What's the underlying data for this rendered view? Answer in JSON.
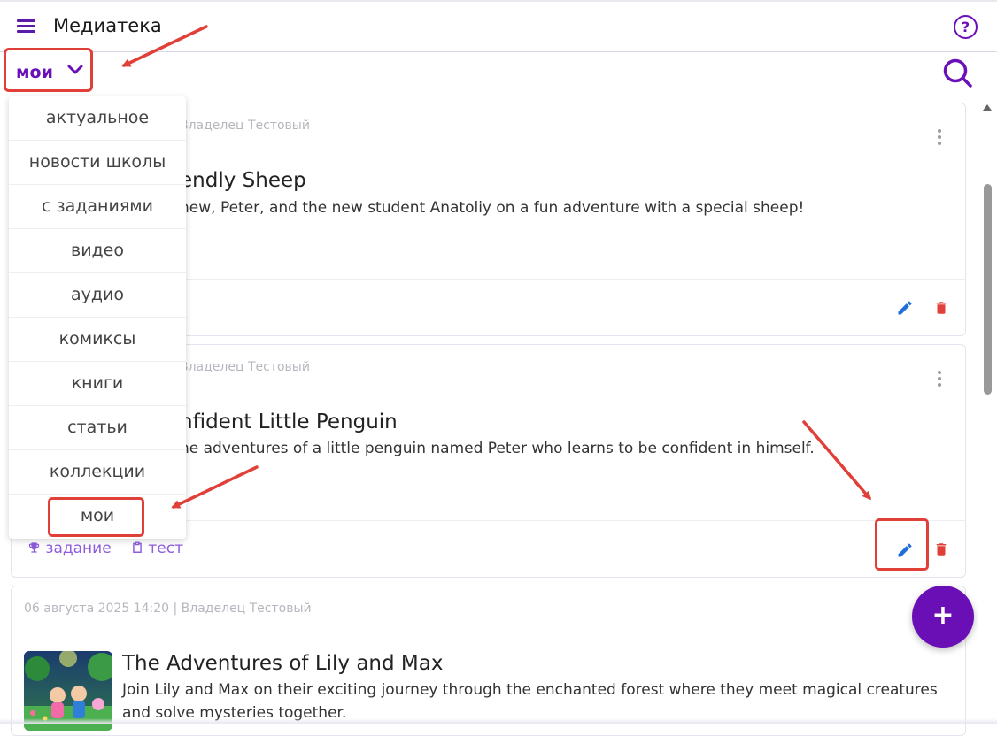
{
  "header": {
    "title": "Медиатека"
  },
  "filter": {
    "selected": "мои"
  },
  "menu": {
    "items": [
      "актуальное",
      "новости школы",
      "с заданиями",
      "видео",
      "аудио",
      "комиксы",
      "книги",
      "статьи",
      "коллекции",
      "мои"
    ]
  },
  "cards": [
    {
      "meta": "Владелец Тестовый",
      "title": "endly Sheep",
      "description": "hew, Peter, and the new student Anatoliy on a fun adventure with a special sheep!"
    },
    {
      "meta": "Владелец Тестовый",
      "title": "nfident Little Penguin",
      "description": "he adventures of a little penguin named Peter who learns to be confident in himself.",
      "tags": [
        "задание",
        "тест"
      ]
    },
    {
      "meta": "06 августа 2025 14:20 | Владелец Тестовый",
      "title": "The Adventures of Lily and Max",
      "description": "Join Lily and Max on their exciting journey through the enchanted forest where they meet magical creatures and solve mysteries together."
    }
  ],
  "fab": {
    "label": "+"
  },
  "colors": {
    "accent": "#6a0eb6",
    "annotation": "#e04038",
    "edit": "#1f6fd6",
    "delete": "#e04038"
  },
  "icons": [
    "menu-icon",
    "help-icon",
    "chevron-down-icon",
    "search-icon",
    "more-vert-icon",
    "edit-icon",
    "trash-icon",
    "trophy-icon",
    "clipboard-icon",
    "plus-icon"
  ]
}
